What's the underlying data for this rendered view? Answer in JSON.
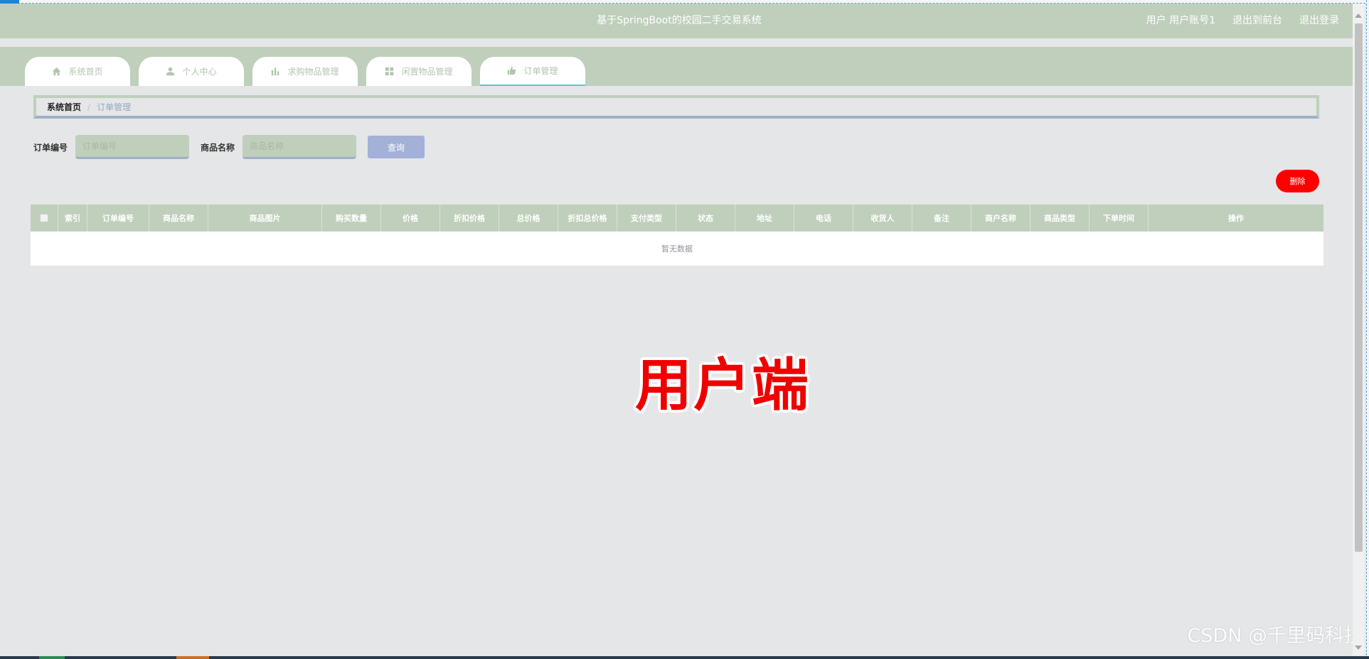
{
  "header": {
    "title": "基于SpringBoot的校园二手交易系统",
    "user_label": "用户 用户账号1",
    "to_front_label": "退出到前台",
    "logout_label": "退出登录"
  },
  "nav": {
    "tabs": [
      {
        "label": "系统首页",
        "icon": "home-icon"
      },
      {
        "label": "个人中心",
        "icon": "person-icon"
      },
      {
        "label": "求购物品管理",
        "icon": "chart-icon"
      },
      {
        "label": "闲置物品管理",
        "icon": "grid-icon"
      },
      {
        "label": "订单管理",
        "icon": "thumb-icon",
        "active": true
      }
    ]
  },
  "breadcrumb": {
    "home": "系统首页",
    "separator": "/",
    "current": "订单管理"
  },
  "search": {
    "order_no_label": "订单编号",
    "order_no_placeholder": "订单编号",
    "product_name_label": "商品名称",
    "product_name_placeholder": "商品名称",
    "query_button": "查询"
  },
  "actions": {
    "delete_button": "删除"
  },
  "table": {
    "columns": [
      "索引",
      "订单编号",
      "商品名称",
      "商品图片",
      "购买数量",
      "价格",
      "折扣价格",
      "总价格",
      "折扣总价格",
      "支付类型",
      "状态",
      "地址",
      "电话",
      "收货人",
      "备注",
      "商户名称",
      "商品类型",
      "下单时间",
      "操作"
    ],
    "empty_text": "暂无数据"
  },
  "overlay_label": "用户端",
  "watermark": "CSDN @千里码科技",
  "colors": {
    "header_bg": "#bfcfbb",
    "page_bg": "#e4e6e7",
    "query_button": "#a3b1d8",
    "delete_button": "#ff0000",
    "overlay_text": "#f00000"
  }
}
